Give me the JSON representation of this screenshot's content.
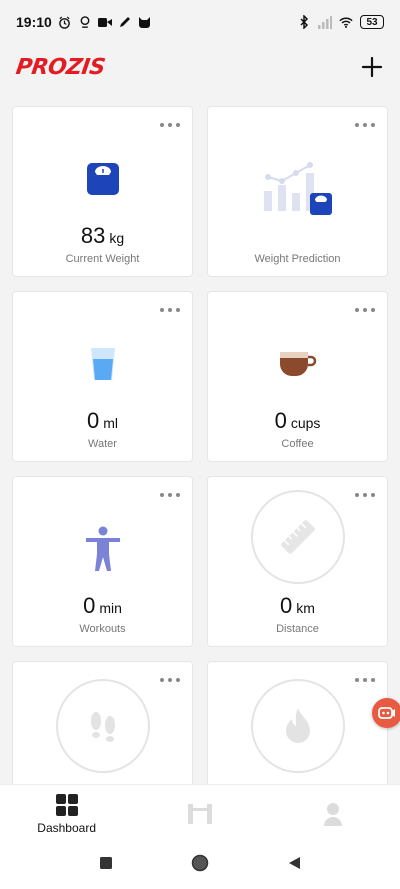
{
  "status_bar": {
    "time": "19:10",
    "battery": "53",
    "left_icons": [
      "alarm-icon",
      "pin-icon",
      "video-icon",
      "pencil-icon",
      "cat-icon"
    ],
    "right_icons": [
      "bluetooth-icon",
      "signal-icon",
      "wifi-icon"
    ]
  },
  "header": {
    "logo_text": "PROZIS",
    "add_icon": "plus-icon"
  },
  "cards": [
    {
      "id": "weight",
      "icon": "scale-icon",
      "value": "83",
      "unit": "kg",
      "label": "Current Weight"
    },
    {
      "id": "prediction",
      "icon": "weight-chart-icon",
      "value": "",
      "unit": "",
      "label": "Weight Prediction"
    },
    {
      "id": "water",
      "icon": "water-glass-icon",
      "value": "0",
      "unit": "ml",
      "label": "Water"
    },
    {
      "id": "coffee",
      "icon": "coffee-cup-icon",
      "value": "0",
      "unit": "cups",
      "label": "Coffee"
    },
    {
      "id": "workouts",
      "icon": "person-icon",
      "value": "0",
      "unit": "min",
      "label": "Workouts"
    },
    {
      "id": "distance",
      "icon": "ruler-icon",
      "value": "0",
      "unit": "km",
      "label": "Distance"
    },
    {
      "id": "steps",
      "icon": "footsteps-icon"
    },
    {
      "id": "calories",
      "icon": "flame-icon"
    }
  ],
  "tabs": [
    {
      "label": "Dashboard",
      "icon": "dashboard-grid-icon",
      "active": true
    },
    {
      "label": "",
      "icon": "dumbbell-icon",
      "active": false
    },
    {
      "label": "",
      "icon": "profile-icon",
      "active": false
    }
  ],
  "nav": [
    "recents-icon",
    "home-icon",
    "back-icon"
  ],
  "colors": {
    "brand": "#e31b23",
    "scale_blue": "#1d44b8",
    "water_blue": "#5aa9f5",
    "coffee_brown": "#8a4a2b",
    "workout_purple": "#7b83d6"
  }
}
